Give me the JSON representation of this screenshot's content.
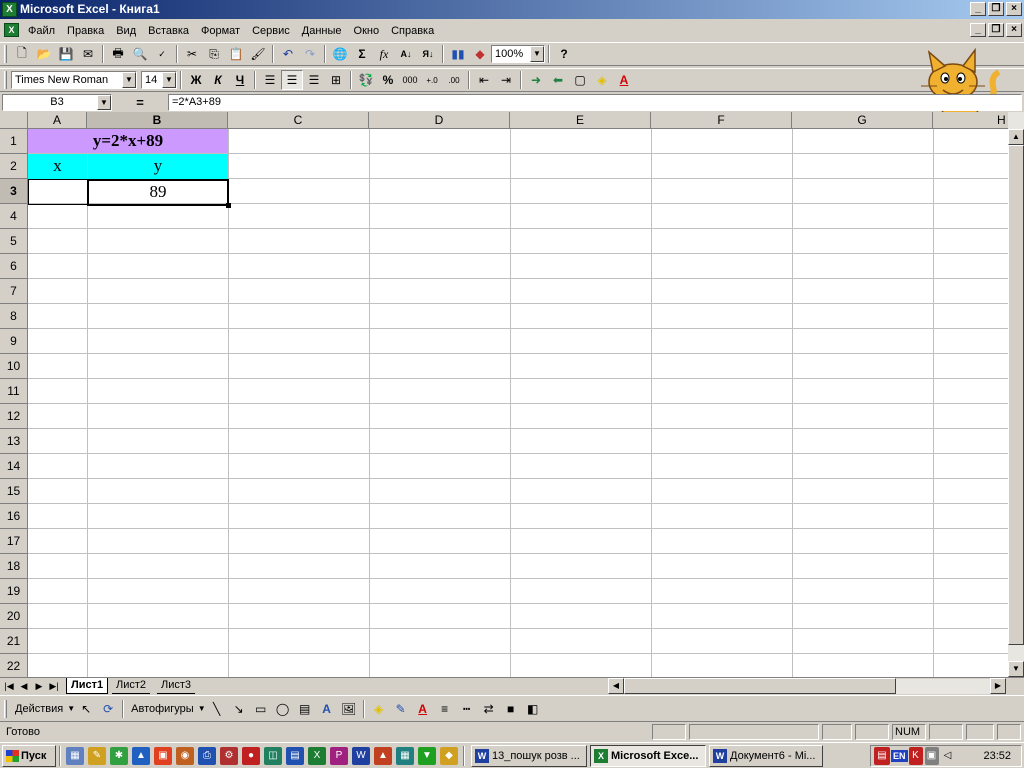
{
  "window": {
    "title": "Microsoft Excel - Книга1"
  },
  "menu": {
    "items": [
      "Файл",
      "Правка",
      "Вид",
      "Вставка",
      "Формат",
      "Сервис",
      "Данные",
      "Окно",
      "Справка"
    ]
  },
  "toolbar": {
    "zoom": "100%"
  },
  "format_toolbar": {
    "font_name": "Times New Roman",
    "font_size": "14",
    "bold": "Ж",
    "italic": "К",
    "underline": "Ч",
    "percent": "%",
    "thousands": "000"
  },
  "formula_bar": {
    "name_box": "B3",
    "equals": "=",
    "formula": "=2*A3+89"
  },
  "grid": {
    "columns": [
      "A",
      "B",
      "C",
      "D",
      "E",
      "F",
      "G",
      "H"
    ],
    "rows": [
      "1",
      "2",
      "3",
      "4",
      "5",
      "6",
      "7",
      "8",
      "9",
      "10",
      "11",
      "12",
      "13",
      "14",
      "15",
      "16",
      "17",
      "18",
      "19",
      "20",
      "21",
      "22"
    ],
    "cells": {
      "A1_B1": "y=2*x+89",
      "A2": "x",
      "B2": "y",
      "B3": "89"
    },
    "colors": {
      "header_purple": "#cc99ff",
      "header_cyan": "#00ffff"
    }
  },
  "sheets": [
    "Лист1",
    "Лист2",
    "Лист3"
  ],
  "drawing_toolbar": {
    "actions": "Действия",
    "autoshapes": "Автофигуры"
  },
  "statusbar": {
    "status": "Готово",
    "num": "NUM"
  },
  "taskbar": {
    "start": "Пуск",
    "tasks": [
      "13_пошук розв ...",
      "Microsoft Exce...",
      "Документ6 - Mi..."
    ],
    "lang": "EN",
    "clock": "23:52"
  }
}
